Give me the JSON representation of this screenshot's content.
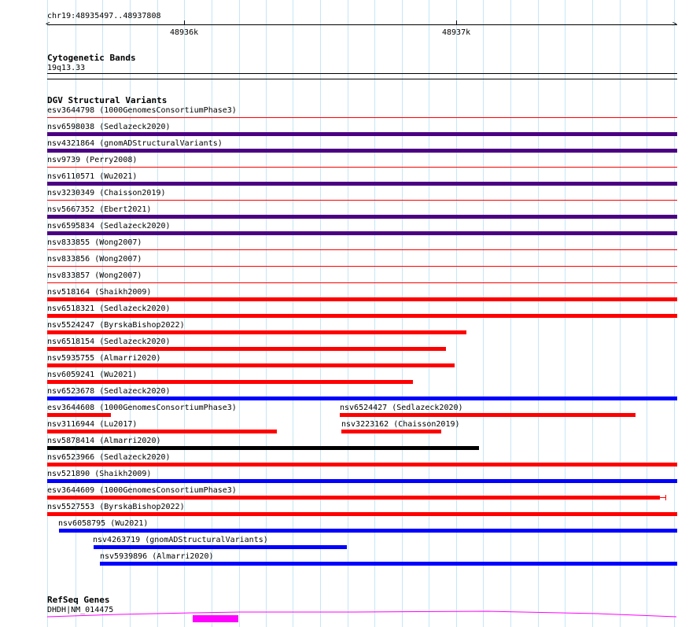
{
  "ruler": {
    "location": "chr19:48935497..48937808",
    "ticks": [
      "48936k",
      "48937k"
    ]
  },
  "cytobands": {
    "title": "Cytogenetic Bands",
    "band": "19q13.33"
  },
  "dgv": {
    "title": "DGV Structural Variants",
    "features": [
      {
        "label": "esv3644798 (1000GenomesConsortiumPhase3)",
        "color": "#ff0000",
        "style": "line"
      },
      {
        "label": "nsv6598038 (Sedlazeck2020)",
        "color": "#4b0082",
        "style": "bar"
      },
      {
        "label": "nsv4321864 (gnomADStructuralVariants)",
        "color": "#4b0082",
        "style": "bar"
      },
      {
        "label": "nsv9739 (Perry2008)",
        "color": "#ff0000",
        "style": "line"
      },
      {
        "label": "nsv6110571 (Wu2021)",
        "color": "#4b0082",
        "style": "bar"
      },
      {
        "label": "nsv3230349 (Chaisson2019)",
        "color": "#ff0000",
        "style": "line"
      },
      {
        "label": "nsv5667352 (Ebert2021)",
        "color": "#4b0082",
        "style": "bar"
      },
      {
        "label": "nsv6595834 (Sedlazeck2020)",
        "color": "#4b0082",
        "style": "bar"
      },
      {
        "label": "nsv833855 (Wong2007)",
        "color": "#ff0000",
        "style": "line"
      },
      {
        "label": "nsv833856 (Wong2007)",
        "color": "#ff0000",
        "style": "line"
      },
      {
        "label": "nsv833857 (Wong2007)",
        "color": "#ff0000",
        "style": "line"
      },
      {
        "label": "nsv518164 (Shaikh2009)",
        "color": "#ff0000",
        "style": "bar"
      },
      {
        "label": "nsv6518321 (Sedlazeck2020)",
        "color": "#ff0000",
        "style": "bar"
      },
      {
        "label": "nsv5524247 (ByrskaBishop2022)",
        "color": "#ff0000",
        "style": "bar"
      },
      {
        "label": "nsv6518154 (Sedlazeck2020)",
        "color": "#ff0000",
        "style": "bar"
      },
      {
        "label": "nsv5935755 (Almarri2020)",
        "color": "#ff0000",
        "style": "bar"
      },
      {
        "label": "nsv6059241 (Wu2021)",
        "color": "#ff0000",
        "style": "bar"
      },
      {
        "label": "nsv6523678 (Sedlazeck2020)",
        "color": "#0000ff",
        "style": "bar"
      },
      {
        "label": "esv3644608 (1000GenomesConsortiumPhase3)",
        "color": "#ff0000",
        "style": "bar"
      },
      {
        "label": "nsv6524427 (Sedlazeck2020)",
        "color": "#ff0000",
        "style": "bar"
      },
      {
        "label": "nsv3116944 (Lu2017)",
        "color": "#ff0000",
        "style": "bar"
      },
      {
        "label": "nsv3223162 (Chaisson2019)",
        "color": "#ff0000",
        "style": "bar"
      },
      {
        "label": "nsv5878414 (Almarri2020)",
        "color": "#000000",
        "style": "bar"
      },
      {
        "label": "nsv6523966 (Sedlazeck2020)",
        "color": "#ff0000",
        "style": "bar"
      },
      {
        "label": "nsv521890 (Shaikh2009)",
        "color": "#0000ff",
        "style": "bar"
      },
      {
        "label": "esv3644609 (1000GenomesConsortiumPhase3)",
        "color": "#ff0000",
        "style": "bar"
      },
      {
        "label": "nsv5527553 (ByrskaBishop2022)",
        "color": "#ff0000",
        "style": "bar"
      },
      {
        "label": "nsv6058795 (Wu2021)",
        "color": "#0000ff",
        "style": "bar"
      },
      {
        "label": "nsv4263719 (gnomADStructuralVariants)",
        "color": "#0000ff",
        "style": "bar"
      },
      {
        "label": "nsv5939896 (Almarri2020)",
        "color": "#0000ff",
        "style": "bar"
      }
    ]
  },
  "refseq": {
    "title": "RefSeq Genes",
    "gene": "DHDH|NM_014475",
    "color": "#ff00ff"
  }
}
